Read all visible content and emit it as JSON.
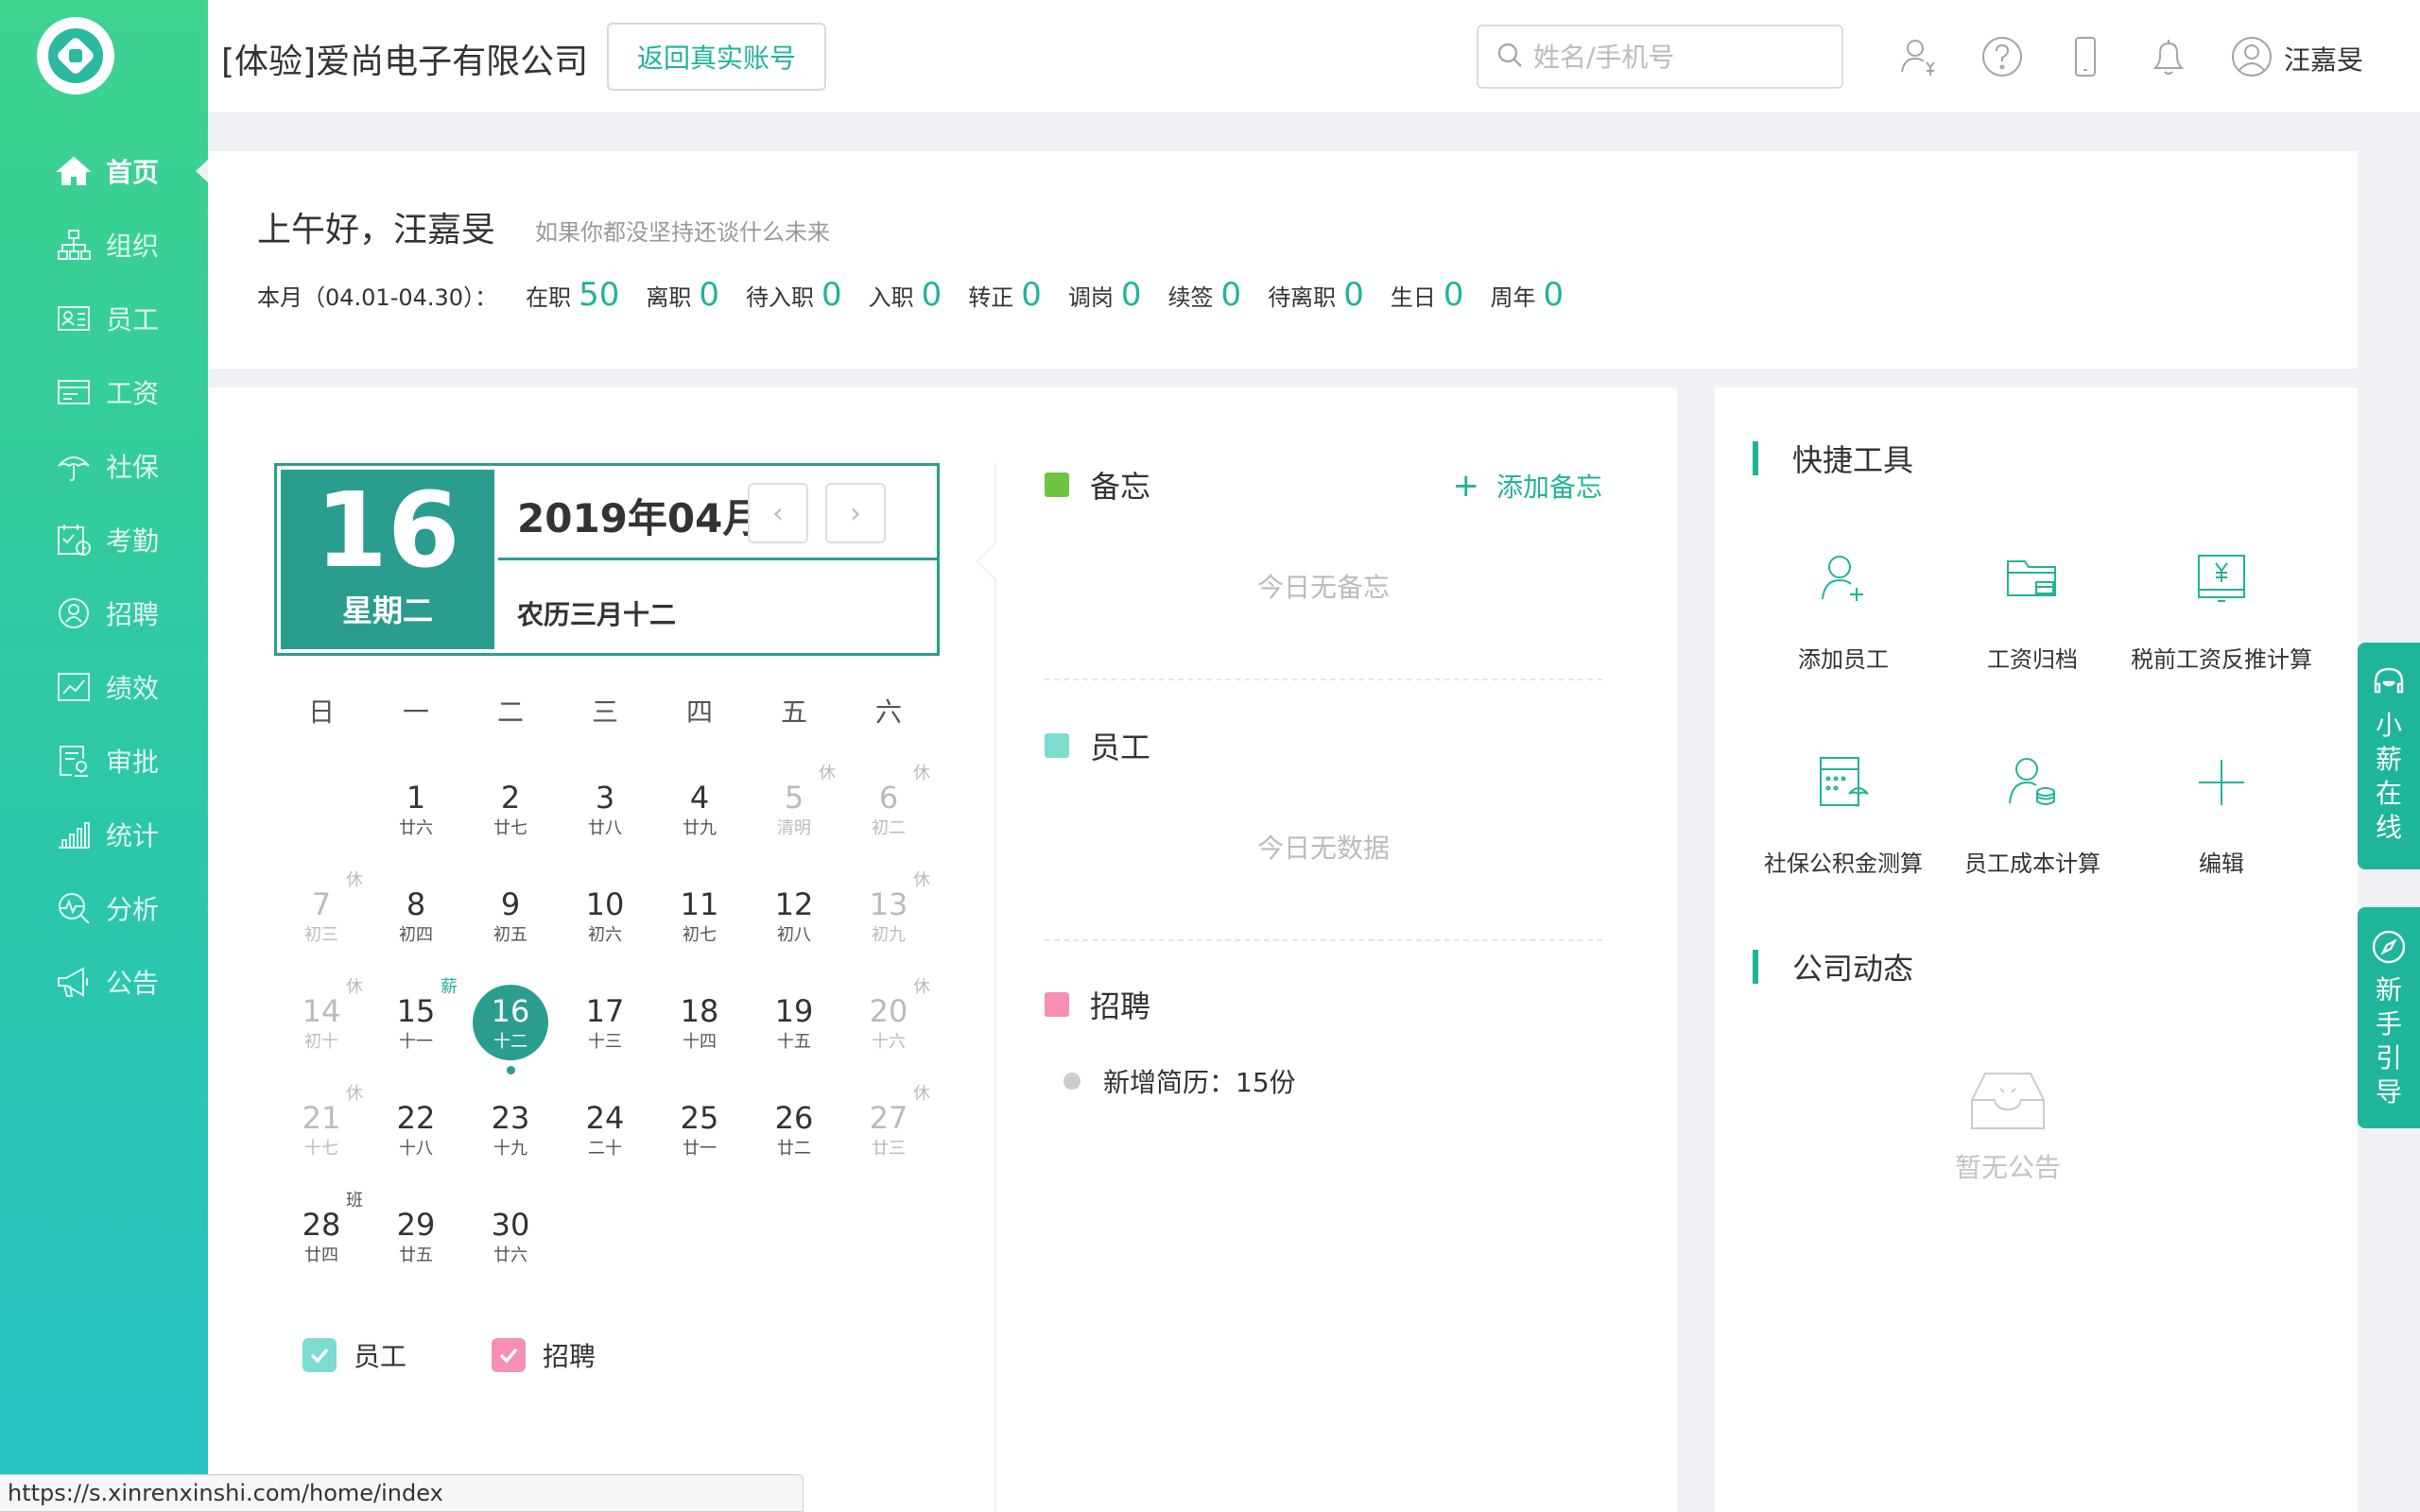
{
  "company": "[体验]爱尚电子有限公司",
  "return_button": "返回真实账号",
  "search_placeholder": "姓名/手机号",
  "user_name": "汪嘉旻",
  "nav": [
    {
      "label": "首页",
      "icon": "home-icon"
    },
    {
      "label": "组织",
      "icon": "org-icon"
    },
    {
      "label": "员工",
      "icon": "employee-card-icon"
    },
    {
      "label": "工资",
      "icon": "salary-icon"
    },
    {
      "label": "社保",
      "icon": "umbrella-icon"
    },
    {
      "label": "考勤",
      "icon": "attendance-icon"
    },
    {
      "label": "招聘",
      "icon": "recruit-icon"
    },
    {
      "label": "绩效",
      "icon": "performance-icon"
    },
    {
      "label": "审批",
      "icon": "approval-icon"
    },
    {
      "label": "统计",
      "icon": "statistics-icon"
    },
    {
      "label": "分析",
      "icon": "analysis-icon"
    },
    {
      "label": "公告",
      "icon": "megaphone-icon"
    }
  ],
  "welcome": {
    "greeting": "上午好，汪嘉旻",
    "motto": "如果你都没坚持还谈什么未来",
    "period": "本月（04.01-04.30）：",
    "stats": [
      {
        "label": "在职",
        "value": "50"
      },
      {
        "label": "离职",
        "value": "0"
      },
      {
        "label": "待入职",
        "value": "0"
      },
      {
        "label": "入职",
        "value": "0"
      },
      {
        "label": "转正",
        "value": "0"
      },
      {
        "label": "调岗",
        "value": "0"
      },
      {
        "label": "续签",
        "value": "0"
      },
      {
        "label": "待离职",
        "value": "0"
      },
      {
        "label": "生日",
        "value": "0"
      },
      {
        "label": "周年",
        "value": "0"
      }
    ]
  },
  "calendar": {
    "day": "16",
    "weekday": "星期二",
    "month_title": "2019年04月",
    "lunar_today": "农历三月十二",
    "prev_glyph": "‹",
    "next_glyph": "›",
    "weekdays": [
      "日",
      "一",
      "二",
      "三",
      "四",
      "五",
      "六"
    ],
    "days": [
      {
        "n": "1",
        "l": "廿六",
        "col": 1,
        "row": 0
      },
      {
        "n": "2",
        "l": "廿七",
        "col": 2,
        "row": 0
      },
      {
        "n": "3",
        "l": "廿八",
        "col": 3,
        "row": 0
      },
      {
        "n": "4",
        "l": "廿九",
        "col": 4,
        "row": 0
      },
      {
        "n": "5",
        "l": "清明",
        "col": 5,
        "row": 0,
        "off": true,
        "tag": "休"
      },
      {
        "n": "6",
        "l": "初二",
        "col": 6,
        "row": 0,
        "off": true,
        "tag": "休"
      },
      {
        "n": "7",
        "l": "初三",
        "col": 0,
        "row": 1,
        "off": true,
        "tag": "休"
      },
      {
        "n": "8",
        "l": "初四",
        "col": 1,
        "row": 1
      },
      {
        "n": "9",
        "l": "初五",
        "col": 2,
        "row": 1
      },
      {
        "n": "10",
        "l": "初六",
        "col": 3,
        "row": 1
      },
      {
        "n": "11",
        "l": "初七",
        "col": 4,
        "row": 1
      },
      {
        "n": "12",
        "l": "初八",
        "col": 5,
        "row": 1
      },
      {
        "n": "13",
        "l": "初九",
        "col": 6,
        "row": 1,
        "off": true,
        "tag": "休"
      },
      {
        "n": "14",
        "l": "初十",
        "col": 0,
        "row": 2,
        "off": true,
        "tag": "休"
      },
      {
        "n": "15",
        "l": "十一",
        "col": 1,
        "row": 2,
        "tag": "薪",
        "tag_color": "#20b39a"
      },
      {
        "n": "16",
        "l": "十二",
        "col": 2,
        "row": 2,
        "today": true
      },
      {
        "n": "17",
        "l": "十三",
        "col": 3,
        "row": 2
      },
      {
        "n": "18",
        "l": "十四",
        "col": 4,
        "row": 2
      },
      {
        "n": "19",
        "l": "十五",
        "col": 5,
        "row": 2
      },
      {
        "n": "20",
        "l": "十六",
        "col": 6,
        "row": 2,
        "off": true,
        "tag": "休"
      },
      {
        "n": "21",
        "l": "十七",
        "col": 0,
        "row": 3,
        "off": true,
        "tag": "休"
      },
      {
        "n": "22",
        "l": "十八",
        "col": 1,
        "row": 3
      },
      {
        "n": "23",
        "l": "十九",
        "col": 2,
        "row": 3
      },
      {
        "n": "24",
        "l": "二十",
        "col": 3,
        "row": 3
      },
      {
        "n": "25",
        "l": "廿一",
        "col": 4,
        "row": 3
      },
      {
        "n": "26",
        "l": "廿二",
        "col": 5,
        "row": 3
      },
      {
        "n": "27",
        "l": "廿三",
        "col": 6,
        "row": 3,
        "off": true,
        "tag": "休"
      },
      {
        "n": "28",
        "l": "廿四",
        "col": 0,
        "row": 4,
        "tag": "班",
        "tag_color": "#555"
      },
      {
        "n": "29",
        "l": "廿五",
        "col": 1,
        "row": 4
      },
      {
        "n": "30",
        "l": "廿六",
        "col": 2,
        "row": 4
      }
    ],
    "legend": [
      {
        "label": "员工",
        "color": "#7ddcd0"
      },
      {
        "label": "招聘",
        "color": "#f58fb3"
      }
    ]
  },
  "memo": {
    "title": "备忘",
    "color": "#6cc644",
    "add_label": "添加备忘",
    "add_glyph": "+",
    "empty": "今日无备忘"
  },
  "employee": {
    "title": "员工",
    "color": "#7ddcd0",
    "empty": "今日无数据"
  },
  "recruit": {
    "title": "招聘",
    "color": "#f58fb3",
    "item": "新增简历：15份"
  },
  "tools": {
    "title": "快捷工具",
    "items": [
      {
        "label": "添加员工",
        "icon": "add-user-icon"
      },
      {
        "label": "工资归档",
        "icon": "folder-card-icon"
      },
      {
        "label": "税前工资反推计算",
        "icon": "yuan-calc-icon"
      },
      {
        "label": "社保公积金测算",
        "icon": "calculator-umbrella-icon"
      },
      {
        "label": "员工成本计算",
        "icon": "user-coins-icon"
      },
      {
        "label": "编辑",
        "icon": "plus-icon"
      }
    ]
  },
  "news": {
    "title": "公司动态",
    "empty": "暂无公告"
  },
  "float_tabs": [
    {
      "label": "小薪在线",
      "icon": "headset-icon"
    },
    {
      "label": "新手引导",
      "icon": "compass-icon"
    }
  ],
  "status_url": "https://s.xinrenxinshi.com/home/index",
  "accent_color": "#20b39a"
}
